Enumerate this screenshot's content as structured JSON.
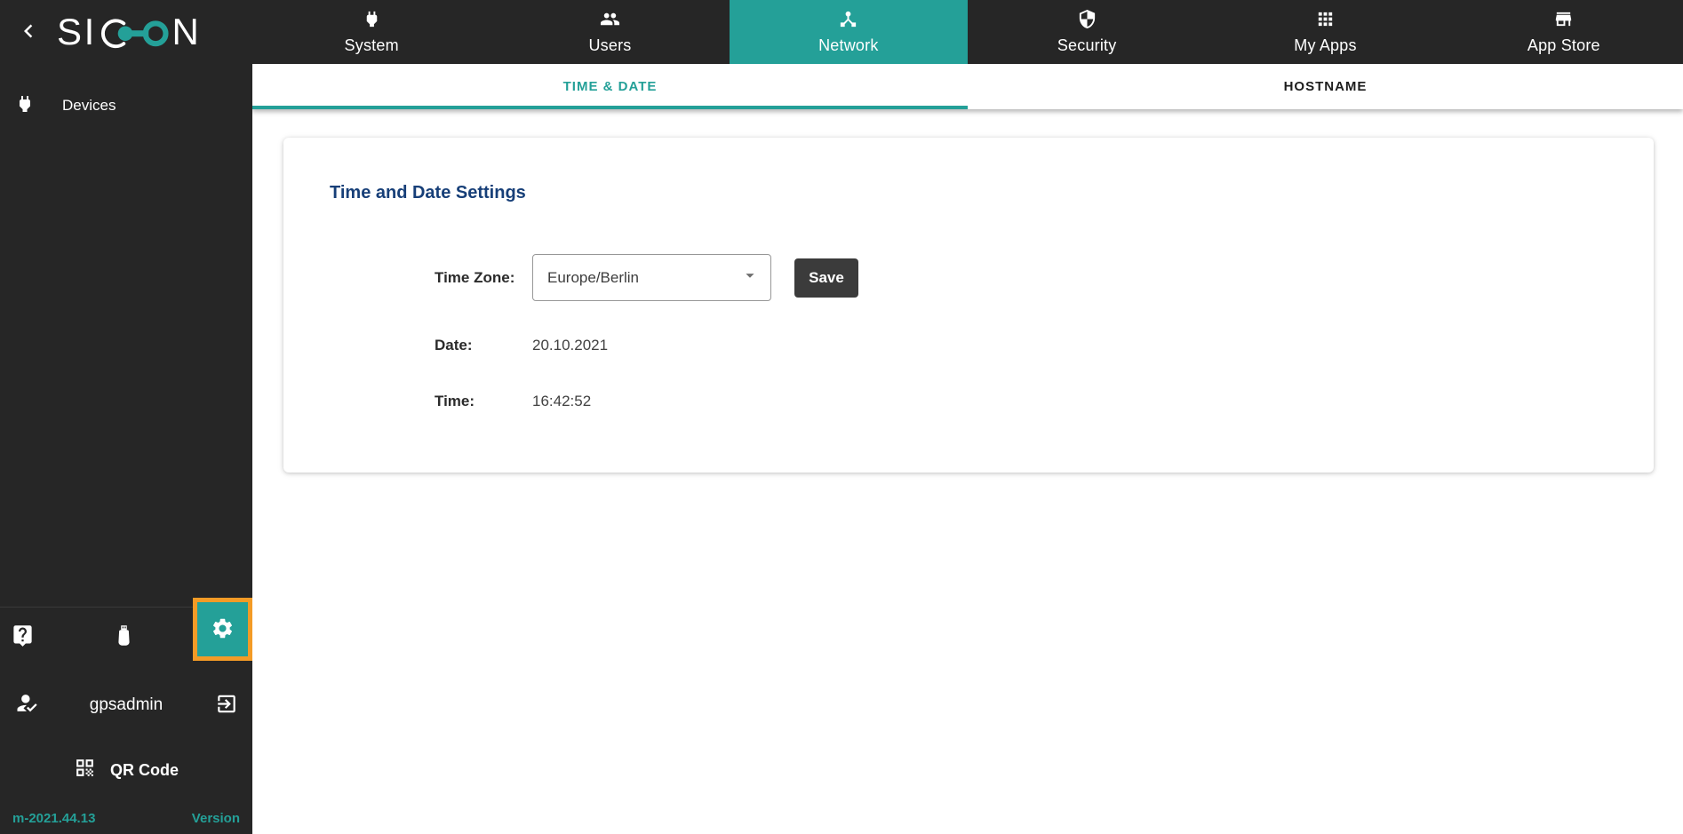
{
  "colors": {
    "teal": "#24a098",
    "orange": "#f39b26",
    "navy": "#173f78",
    "dark": "#262626"
  },
  "sidebar": {
    "logo_text": "SICON",
    "back_icon": "chevron-left-icon",
    "items": [
      {
        "label": "Devices",
        "icon": "plug-icon"
      }
    ],
    "tools": [
      {
        "icon": "help-bubble-icon"
      },
      {
        "icon": "usb-stick-icon"
      },
      {
        "icon": "gear-icon",
        "selected": true
      }
    ],
    "user": {
      "name": "gpsadmin",
      "icon": "person-check-icon",
      "logout_icon": "exit-icon"
    },
    "qr_label": "QR Code",
    "qr_icon": "qr-code-icon",
    "version_value": "m-2021.44.13",
    "version_label": "Version"
  },
  "topnav": {
    "tabs": [
      {
        "label": "System",
        "icon": "plug-icon",
        "active": false
      },
      {
        "label": "Users",
        "icon": "people-icon",
        "active": false
      },
      {
        "label": "Network",
        "icon": "device-hub-icon",
        "active": true
      },
      {
        "label": "Security",
        "icon": "shield-icon",
        "active": false
      },
      {
        "label": "My Apps",
        "icon": "apps-grid-icon",
        "active": false
      },
      {
        "label": "App Store",
        "icon": "storefront-icon",
        "active": false
      }
    ]
  },
  "subtabs": [
    {
      "label": "TIME & DATE",
      "active": true
    },
    {
      "label": "HOSTNAME",
      "active": false
    }
  ],
  "content": {
    "heading": "Time and Date Settings",
    "timezone_label": "Time Zone:",
    "timezone_value": "Europe/Berlin",
    "save_label": "Save",
    "date_label": "Date:",
    "date_value": "20.10.2021",
    "time_label": "Time:",
    "time_value": "16:42:52"
  }
}
